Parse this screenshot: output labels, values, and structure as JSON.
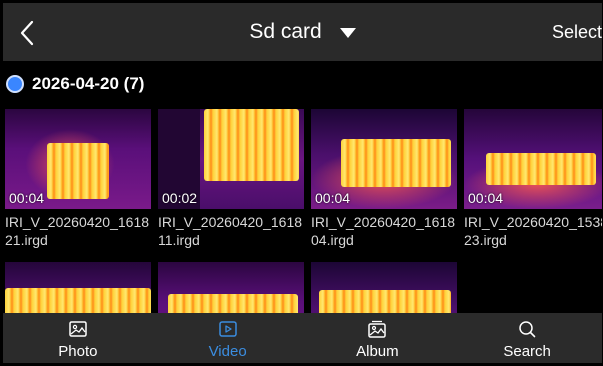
{
  "header": {
    "title": "Sd card",
    "select_label": "Select"
  },
  "group": {
    "title": "2026-04-20 (7)"
  },
  "videos": [
    {
      "duration": "00:04",
      "filename": "IRI_V_20260420_161821.irgd",
      "selected": false
    },
    {
      "duration": "00:02",
      "filename": "IRI_V_20260420_161811.irgd",
      "selected": false
    },
    {
      "duration": "00:04",
      "filename": "IRI_V_20260420_161804.irgd",
      "selected": true
    },
    {
      "duration": "00:04",
      "filename": "IRI_V_20260420_153823.irgd",
      "selected": false
    }
  ],
  "tabs": [
    {
      "label": "Photo",
      "icon": "image-icon",
      "active": false
    },
    {
      "label": "Video",
      "icon": "video-icon",
      "active": true
    },
    {
      "label": "Album",
      "icon": "album-icon",
      "active": false
    },
    {
      "label": "Search",
      "icon": "search-icon",
      "active": false
    }
  ],
  "colors": {
    "accent": "#3b8de0",
    "selection": "#4a90e2",
    "bar": "#2b2b2b"
  }
}
